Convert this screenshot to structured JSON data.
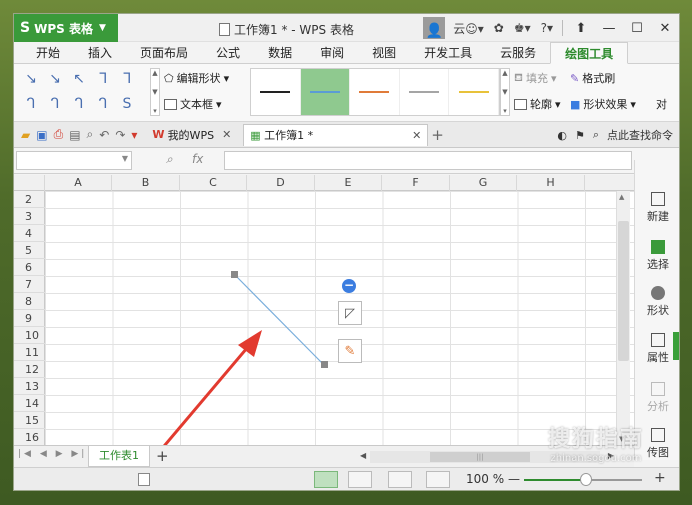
{
  "window": {
    "app_name": "WPS 表格",
    "title": "工作簿1 * - WPS 表格",
    "user_initial": "云",
    "help_label": "?"
  },
  "menu_tabs": [
    "开始",
    "插入",
    "页面布局",
    "公式",
    "数据",
    "审阅",
    "视图",
    "开发工具",
    "云服务",
    "绘图工具"
  ],
  "active_menu_tab": "绘图工具",
  "ribbon": {
    "connector_glyphs": [
      "↘",
      "↘",
      "↖",
      "ᒣ",
      "ᒣ",
      "ᒉ",
      "ᒉ",
      "ᒉ",
      "ᒉ",
      "S"
    ],
    "edit_shape": "编辑形状",
    "text_box": "文本框",
    "fill": "填充",
    "format_painter": "格式刷",
    "outline": "轮廓",
    "shape_effect": "形状效果",
    "extra": "对",
    "line_styles": [
      {
        "color": "#222222",
        "selected": false
      },
      {
        "color": "#5b9bd5",
        "selected": true
      },
      {
        "color": "#e07b39",
        "selected": false
      },
      {
        "color": "#a5a5a5",
        "selected": false
      },
      {
        "color": "#e8c23a",
        "selected": false
      }
    ]
  },
  "doc_tabs": {
    "wps_tab": "我的WPS",
    "book_tab": "工作簿1 *",
    "search_cmd": "点此查找命令"
  },
  "formula_bar": {
    "fx": "fx",
    "name_box": "",
    "content": ""
  },
  "columns": [
    "A",
    "B",
    "C",
    "D",
    "E",
    "F",
    "G",
    "H"
  ],
  "rows": [
    "2",
    "3",
    "4",
    "5",
    "6",
    "7",
    "8",
    "9",
    "10",
    "11",
    "12",
    "13",
    "14",
    "15",
    "16"
  ],
  "right_panel": {
    "items": [
      {
        "label": "新建",
        "icon": "new-icon",
        "dim": false
      },
      {
        "label": "选择",
        "icon": "select-icon",
        "dim": false
      },
      {
        "label": "形状",
        "icon": "shape-icon",
        "dim": false
      },
      {
        "label": "属性",
        "icon": "property-icon",
        "dim": false
      },
      {
        "label": "分析",
        "icon": "analysis-icon",
        "dim": true
      },
      {
        "label": "传图",
        "icon": "upload-image-icon",
        "dim": false
      }
    ]
  },
  "sheet_tabs": {
    "active": "工作表1",
    "add": "+"
  },
  "status": {
    "zoom": "100 %",
    "zoom_minus": "—",
    "zoom_plus": "+"
  },
  "watermark": {
    "brand": "搜狗指南",
    "url": "zhinan.sogou.com"
  },
  "colors": {
    "accent": "#3a9a3a",
    "line_shape": "#7aaedc",
    "arrow": "#e23a2f"
  }
}
